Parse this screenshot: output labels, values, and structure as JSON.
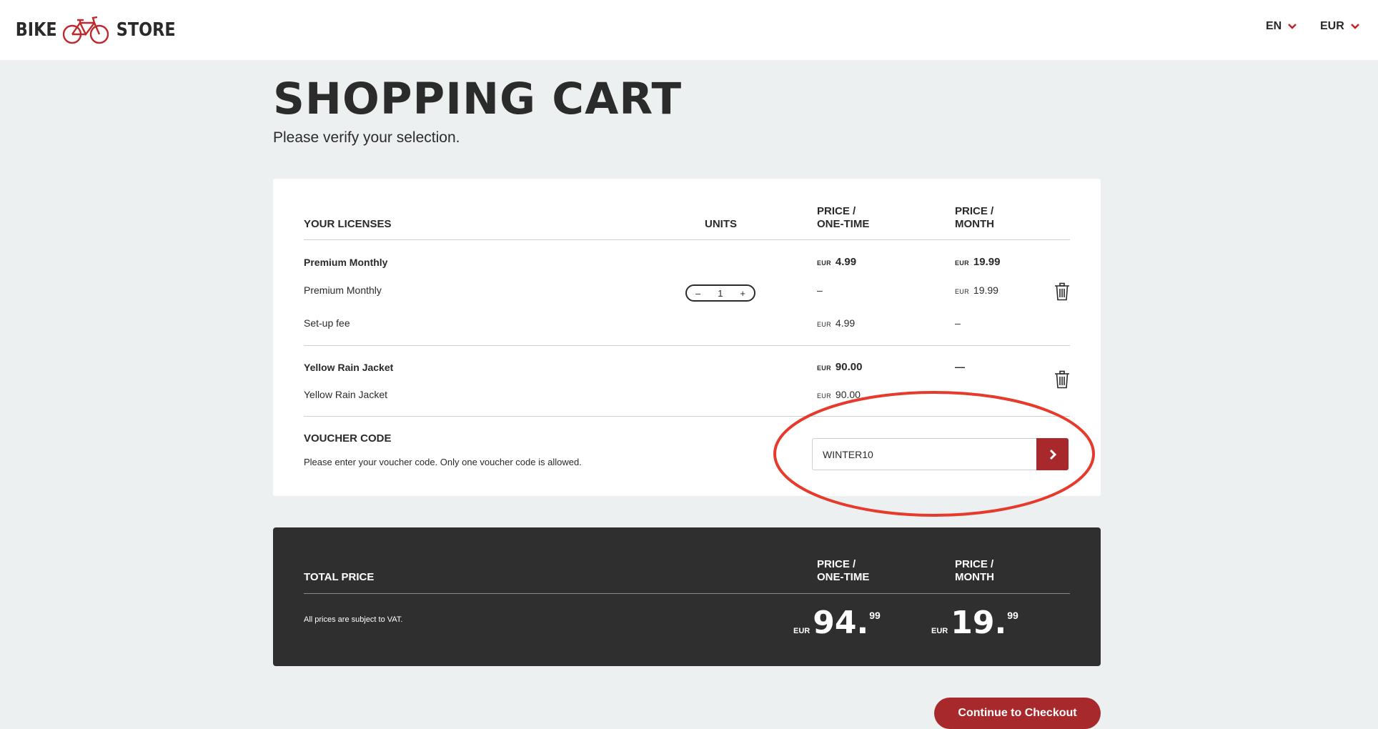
{
  "header": {
    "logo_left": "BIKE",
    "logo_right": "STORE",
    "language": "EN",
    "currency": "EUR"
  },
  "page": {
    "title": "SHOPPING CART",
    "subtitle": "Please verify your selection."
  },
  "cart": {
    "columns": {
      "licenses": "YOUR LICENSES",
      "units": "UNITS",
      "price_once_1": "PRICE /",
      "price_once_2": "ONE-TIME",
      "price_month_1": "PRICE /",
      "price_month_2": "MONTH"
    },
    "items": [
      {
        "name": "Premium Monthly",
        "one_time_cur": "EUR",
        "one_time": "4.99",
        "monthly_cur": "EUR",
        "monthly": "19.99",
        "lines": [
          {
            "label": "Premium Monthly",
            "units": "1",
            "one_time": "–",
            "monthly_cur": "EUR",
            "monthly": "19.99"
          },
          {
            "label": "Set-up fee",
            "one_time_cur": "EUR",
            "one_time": "4.99",
            "monthly": "–"
          }
        ]
      },
      {
        "name": "Yellow Rain Jacket",
        "one_time_cur": "EUR",
        "one_time": "90.00",
        "monthly": "—",
        "lines": [
          {
            "label": "Yellow Rain Jacket",
            "one_time_cur": "EUR",
            "one_time": "90.00"
          }
        ]
      }
    ],
    "stepper": {
      "minus": "–",
      "plus": "+"
    }
  },
  "voucher": {
    "title": "VOUCHER CODE",
    "hint": "Please enter your voucher code. Only one voucher code is allowed.",
    "value": "WINTER10"
  },
  "total": {
    "label": "TOTAL PRICE",
    "vat_note": "All prices are subject to VAT.",
    "price_once_1": "PRICE /",
    "price_once_2": "ONE-TIME",
    "price_month_1": "PRICE /",
    "price_month_2": "MONTH",
    "one_time_cur": "EUR",
    "one_time_int": "94.",
    "one_time_dec": "99",
    "monthly_cur": "EUR",
    "monthly_int": "19.",
    "monthly_dec": "99"
  },
  "checkout": {
    "label": "Continue to Checkout"
  },
  "colors": {
    "accent": "#a8292b",
    "dark_panel": "#2f2f2f",
    "page_bg": "#edf0f0",
    "highlight": "#e63a2c"
  },
  "icons": [
    "bicycle-icon",
    "chevron-down-icon",
    "trash-icon",
    "chevron-right-icon"
  ]
}
